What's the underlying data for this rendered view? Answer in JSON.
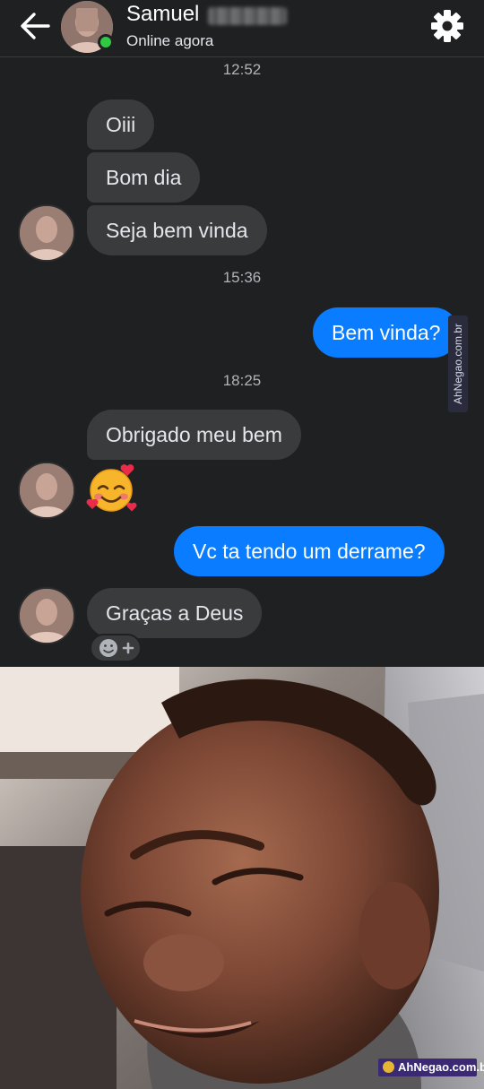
{
  "header": {
    "contact_name": "Samuel",
    "contact_status": "Online agora"
  },
  "messages": [
    {
      "type": "timestamp",
      "text": "12:52"
    },
    {
      "type": "incoming",
      "text": "Oiii"
    },
    {
      "type": "incoming",
      "text": "Bom dia"
    },
    {
      "type": "incoming",
      "text": "Seja bem vinda"
    },
    {
      "type": "timestamp",
      "text": "15:36"
    },
    {
      "type": "outgoing",
      "text": "Bem vinda?"
    },
    {
      "type": "timestamp",
      "text": "18:25"
    },
    {
      "type": "incoming",
      "text": "Obrigado meu bem"
    },
    {
      "type": "incoming-emoji",
      "icon": "smiling-face-with-hearts-icon"
    },
    {
      "type": "outgoing",
      "text": "Vc ta tendo um derrame?"
    },
    {
      "type": "incoming",
      "text": "Graças a Deus"
    }
  ],
  "watermark": {
    "text": "AhNegao.com.br"
  },
  "colors": {
    "background": "#1f2022",
    "incoming_bubble": "#3a3b3d",
    "outgoing_bubble": "#0a7cff",
    "online": "#31c843"
  }
}
